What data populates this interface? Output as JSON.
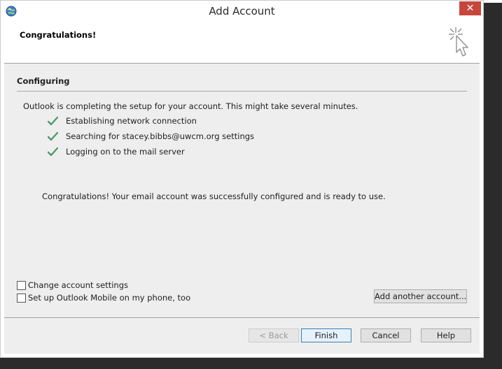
{
  "window": {
    "title": "Add Account",
    "close_label": "✕"
  },
  "header": {
    "title": "Congratulations!"
  },
  "main": {
    "section_title": "Configuring",
    "intro": "Outlook is completing the setup for your account. This might take several minutes.",
    "steps": [
      {
        "label": "Establishing network connection",
        "status": "complete"
      },
      {
        "label": "Searching for stacey.bibbs@uwcm.org settings",
        "status": "complete"
      },
      {
        "label": "Logging on to the mail server",
        "status": "complete"
      }
    ],
    "success_message": "Congratulations! Your email account was successfully configured and is ready to use."
  },
  "options": {
    "change_settings_label": "Change account settings",
    "change_settings_checked": false,
    "mobile_label": "Set up Outlook Mobile on my phone, too",
    "mobile_checked": false,
    "add_another_label": "Add another account..."
  },
  "footer": {
    "back_label": "< Back",
    "finish_label": "Finish",
    "cancel_label": "Cancel",
    "help_label": "Help"
  },
  "colors": {
    "close_button": "#c7463c",
    "check_mark": "#4d9a6f",
    "default_button_border": "#3c7fb1"
  }
}
